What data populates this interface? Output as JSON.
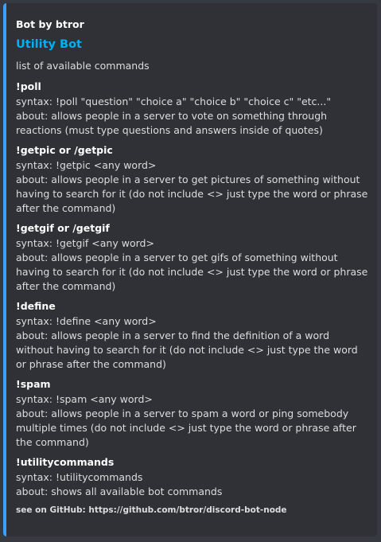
{
  "embed": {
    "accent_color": "#3aa0ff",
    "author": "Bot by btror",
    "title": "Utility Bot",
    "description": "list of available commands",
    "fields": [
      {
        "name": "!poll",
        "syntax": "syntax: !poll \"question\" \"choice a\" \"choice b\" \"choice c\" \"etc...\"",
        "about": "about: allows people in a server to vote on something through reactions (must type questions and answers inside of quotes)"
      },
      {
        "name": "!getpic or /getpic",
        "syntax": "syntax: !getpic <any word>",
        "about": "about: allows people in a server to get pictures of something without having to search for it (do not include <> just type the word or phrase after the command)"
      },
      {
        "name": "!getgif or /getgif",
        "syntax": "syntax: !getgif <any word>",
        "about": "about: allows people in a server to get gifs of something without having to search for it (do not include <> just type the word or phrase after the command)"
      },
      {
        "name": "!define",
        "syntax": "syntax: !define <any word>",
        "about": "about: allows people in a server to find the definition of a word without having to search for it (do not include <> just type the word or phrase after the command)"
      },
      {
        "name": "!spam",
        "syntax": "syntax: !spam <any word>",
        "about": "about: allows people in a server to spam a word or ping somebody multiple times (do not include <> just type the word or phrase after the command)"
      },
      {
        "name": "!utilitycommands",
        "syntax": "syntax: !utilitycommands",
        "about": "about: shows all available bot commands"
      }
    ],
    "footer": "see on GitHub: https://github.com/btror/discord-bot-node"
  }
}
